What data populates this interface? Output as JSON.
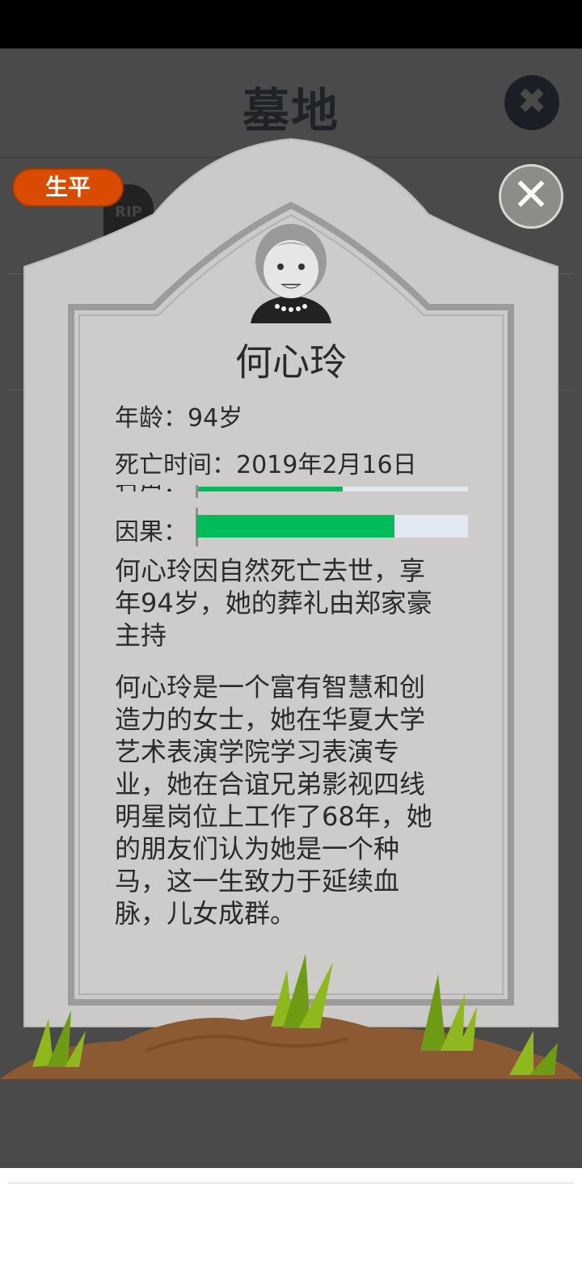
{
  "header": {
    "title": "墓地",
    "close_label": "✖"
  },
  "badge": {
    "label": "生平"
  },
  "background": {
    "rip_text": "RIP"
  },
  "dialog": {
    "close_label": "✕"
  },
  "deceased": {
    "name": "何心玲",
    "age_line": "年龄：94岁",
    "death_line": "死亡时间：2019年2月16日",
    "bars": [
      {
        "label": "名声：",
        "value": 0.54
      },
      {
        "label": "因果：",
        "value": 0.73
      }
    ],
    "summary": "何心玲因自然死亡去世，享年94岁，她的葬礼由郑家豪主持",
    "biography": "何心玲是一个富有智慧和创造力的女士，她在华夏大学艺术表演学院学习表演专业，她在合谊兄弟影视四线明星岗位上工作了68年，她的朋友们认为她是一个种马，这一生致力于延续血脉，儿女成群。"
  },
  "colors": {
    "accent": "#d94c00",
    "bar_fill": "#00bb5a",
    "bar_track": "#e1e8f1",
    "stone": "#cbcac8",
    "soil": "#8b5a33",
    "grass": "#8fb81f"
  }
}
